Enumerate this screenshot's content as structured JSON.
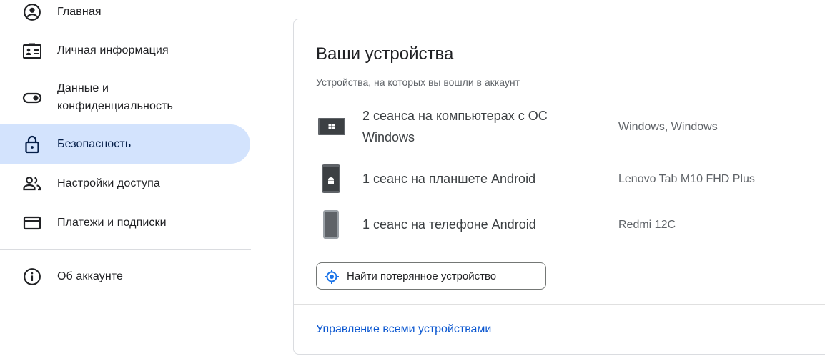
{
  "sidebar": {
    "items": [
      {
        "label": "Главная",
        "icon": "account-circle-icon"
      },
      {
        "label": "Личная информация",
        "icon": "id-card-icon"
      },
      {
        "label": "Данные и конфиденциальность",
        "icon": "toggle-icon"
      },
      {
        "label": "Безопасность",
        "icon": "lock-icon",
        "active": true
      },
      {
        "label": "Настройки доступа",
        "icon": "people-icon"
      },
      {
        "label": "Платежи и подписки",
        "icon": "credit-card-icon"
      },
      {
        "label": "Об аккаунте",
        "icon": "info-icon"
      }
    ]
  },
  "devices_card": {
    "title": "Ваши устройства",
    "subtitle": "Устройства, на которых вы вошли в аккаунт",
    "devices": [
      {
        "title": "2 сеанса на компьютерах с ОС Windows",
        "detail": "Windows, Windows",
        "icon": "windows-computer-icon"
      },
      {
        "title": "1 сеанс на планшете Android",
        "detail": "Lenovo Tab M10 FHD Plus",
        "icon": "android-tablet-icon"
      },
      {
        "title": "1 сеанс на телефоне Android",
        "detail": "Redmi 12C",
        "icon": "android-phone-icon"
      }
    ],
    "find_button_label": "Найти потерянное устройство",
    "manage_link": "Управление всеми устройствами"
  },
  "colors": {
    "accent": "#0b57d0",
    "active_nav_bg": "#d3e3fd",
    "border": "#dadce0"
  }
}
